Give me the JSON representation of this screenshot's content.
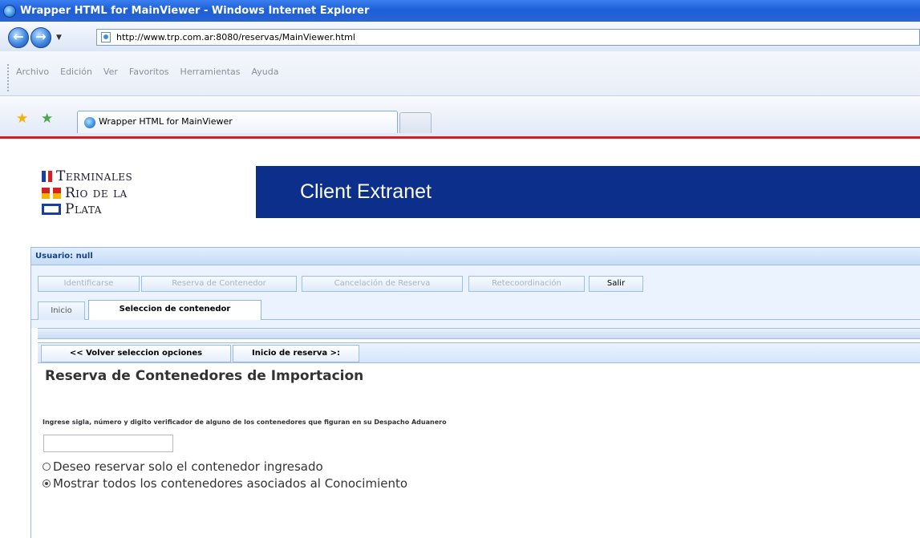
{
  "window": {
    "title": "Wrapper HTML for MainViewer - Windows Internet Explorer"
  },
  "address_bar": {
    "url": "http://www.trp.com.ar:8080/reservas/MainViewer.html"
  },
  "menu": {
    "items": [
      "Archivo",
      "Edición",
      "Ver",
      "Favoritos",
      "Herramientas",
      "Ayuda"
    ]
  },
  "browser_tabs": {
    "active_label": "Wrapper HTML for MainViewer"
  },
  "logo": {
    "line1": "Terminales",
    "line2": "Rio de la",
    "line3": "Plata"
  },
  "banner": {
    "title": "Client Extranet"
  },
  "app": {
    "user_label": "Usuario: null",
    "toolbar": [
      {
        "label": "Identificarse",
        "enabled": false
      },
      {
        "label": "Reserva de Contenedor",
        "enabled": false
      },
      {
        "label": "Cancelación de Reserva",
        "enabled": false
      },
      {
        "label": "Retecoordinación",
        "enabled": false
      },
      {
        "label": "Salir",
        "enabled": true
      }
    ],
    "tabs": [
      {
        "label": "Inicio",
        "active": false
      },
      {
        "label": "Seleccion de contenedor",
        "active": true
      }
    ],
    "wizard": {
      "back_label": "<< Volver seleccion opciones",
      "next_label": "Inicio de reserva >:"
    },
    "content": {
      "title": "Reserva de Contenedores de Importacion",
      "instructions": "Ingrese sigla, número y digito verificador de alguno de los contenedores que figuran en su Despacho Aduanero",
      "container_input_value": "",
      "options": [
        {
          "label": "Deseo reservar solo el contenedor ingresado",
          "checked": false
        },
        {
          "label": "Mostrar todos los contenedores asociados al Conocimiento",
          "checked": true
        }
      ]
    }
  }
}
